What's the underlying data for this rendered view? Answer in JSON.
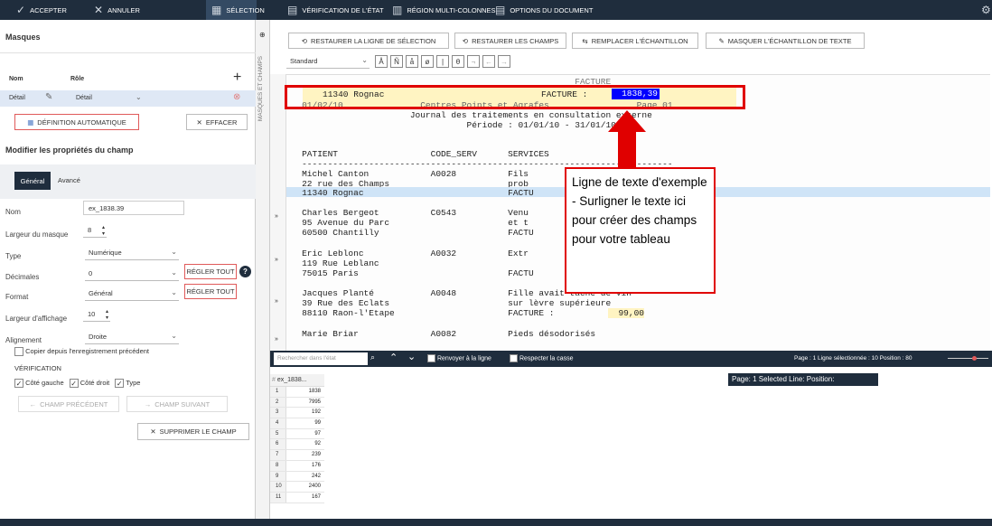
{
  "toolbar": {
    "accept": "ACCEPTER",
    "cancel": "ANNULER",
    "selection": "SÉLECTION",
    "verify": "VÉRIFICATION DE L'ÉTAT",
    "multi": "RÉGION MULTI-COLONNES",
    "options": "OPTIONS DU DOCUMENT"
  },
  "masks": {
    "title": "Masques",
    "col_name": "Nom",
    "col_role": "Rôle",
    "row_name": "Détail",
    "row_role": "Détail",
    "auto_def": "DÉFINITION AUTOMATIQUE",
    "clear": "EFFACER",
    "vertical_tab": "MASQUES ET CHAMPS"
  },
  "props": {
    "title": "Modifier les propriétés du champ",
    "tab_general": "Général",
    "tab_adv": "Avancé",
    "name_label": "Nom",
    "name_value": "ex_1838.39",
    "width_label": "Largeur du masque",
    "width_value": "8",
    "type_label": "Type",
    "type_value": "Numérique",
    "dec_label": "Décimales",
    "dec_value": "0",
    "set_all": "RÉGLER TOUT",
    "format_label": "Format",
    "format_value": "Général",
    "disp_label": "Largeur d'affichage",
    "disp_value": "10",
    "align_label": "Alignement",
    "align_value": "Droite",
    "copy_prev": "Copier depuis l'enregistrement précédent",
    "verif": "VÉRIFICATION",
    "left_side": "Côté gauche",
    "right_side": "Côté droit",
    "type_cb": "Type",
    "prev_field": "CHAMP PRÉCÉDENT",
    "next_field": "CHAMP SUIVANT",
    "delete_field": "SUPPRIMER LE CHAMP"
  },
  "center": {
    "restore_line": "RESTAURER LA LIGNE DE SÉLECTION",
    "restore_fields": "RESTAURER LES CHAMPS",
    "replace_sample": "REMPLACER L'ÉCHANTILLON",
    "hide_sample": "MASQUER L'ÉCHANTILLON DE TEXTE",
    "style_select": "Standard",
    "search_placeholder": "Rechercher dans l'état",
    "wrap": "Renvoyer à la ligne",
    "case": "Respecter la casse",
    "status": "Page : 1   Ligne sélectionnée : 10   Position : 80",
    "status2": "Page: 1  Selected Line:  Position:",
    "callout": "Ligne de texte d'exemple - Surligner le texte ici pour créer des champs pour votre tableau",
    "grid_header": "ex_1838...",
    "doc": {
      "sample_left": "11340 Rognac",
      "sample_mid": "FACTURE :",
      "sample_value": "1838,39",
      "l0": "                                                        FACTURE",
      "l2": "   01/02/10               Centres Points et Agrafes                 Page 01",
      "l3": "                        Journal des traitements en consultation externe",
      "l4": "                                   Période : 01/01/10 - 31/01/10",
      "l5": "   PATIENT                  CODE_SERV      SERVICES",
      "l6": "   ------------------------------------------------------------------------",
      "l7": "   Michel Canton            A0028          Fils",
      "l8": "   22 rue des Champs                       prob",
      "l9": "   11340 Rognac                            FACTU",
      "l10": "   Charles Bergeot          C0543          Venu",
      "l11": "   95 Avenue du Parc                       et t",
      "l12": "   60500 Chantilly                         FACTU",
      "l13": "   Eric Leblonc             A0032          Extr",
      "l14": "   119 Rue Leblanc",
      "l15": "   75015 Paris                             FACTU",
      "l16": "   Jacques Planté           A0048          Fille avait tache de vin",
      "l17": "   39 Rue des Eclats                       sur lèvre supérieure",
      "l18": "   88110 Raon-l'Etape                      FACTURE :",
      "l18v": "99,00",
      "l19": "   Marie Briar              A0082          Pieds désodorisés"
    },
    "grid_values": [
      "1838",
      "7995",
      "192",
      "99",
      "97",
      "92",
      "239",
      "176",
      "242",
      "2400",
      "167"
    ]
  },
  "colors": {
    "accent": "#1f2d3d",
    "highlight": "#fff4c2",
    "selection": "#0000ff",
    "callout_border": "#e00000"
  }
}
